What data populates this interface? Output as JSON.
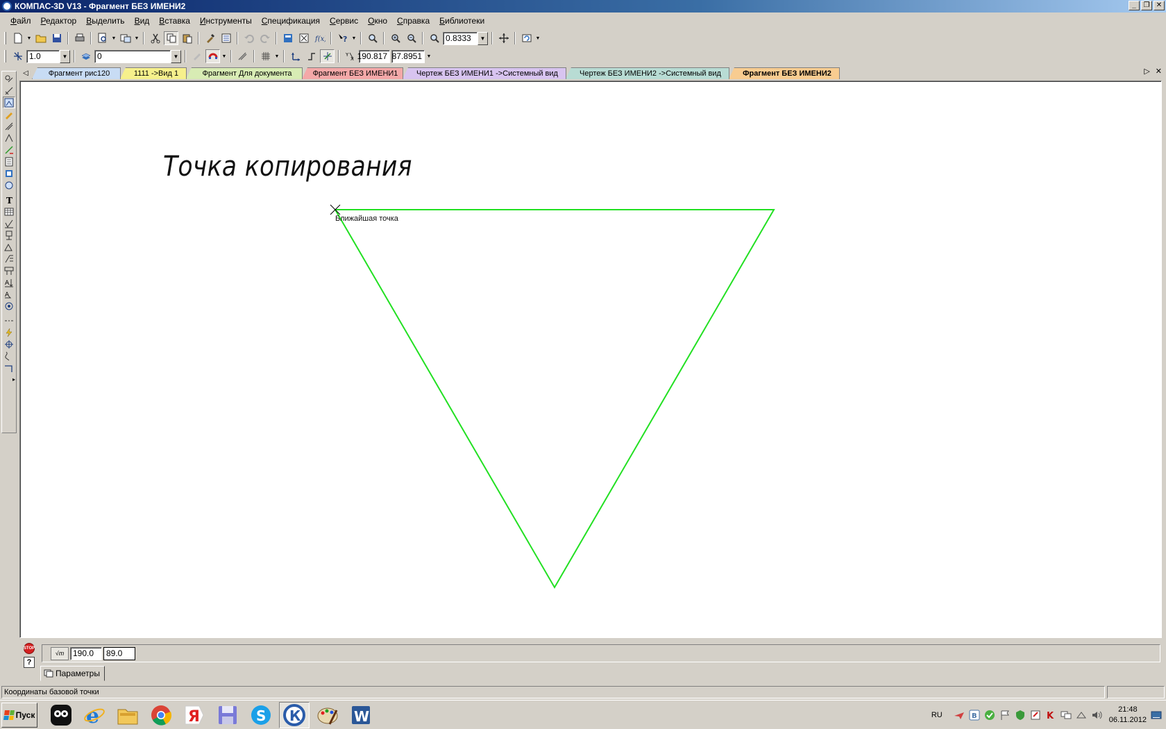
{
  "window": {
    "title": "КОМПАС-3D V13 - Фрагмент БЕЗ ИМЕНИ2"
  },
  "menu": [
    "Файл",
    "Редактор",
    "Выделить",
    "Вид",
    "Вставка",
    "Инструменты",
    "Спецификация",
    "Сервис",
    "Окно",
    "Справка",
    "Библиотеки"
  ],
  "toolbar1": {
    "zoom_value": "0.8333"
  },
  "toolbar2": {
    "step_value": "1.0",
    "layer_value": "0",
    "coord_x": "190.817",
    "coord_y": "87.8951"
  },
  "tabs": [
    {
      "label": "Фрагмент рис120",
      "color": "#c8dcf4"
    },
    {
      "label": "1111 ->Вид 1",
      "color": "#f6f08c"
    },
    {
      "label": "Фрагмент Для документа",
      "color": "#d8ecb4"
    },
    {
      "label": "Фрагмент БЕЗ ИМЕНИ1",
      "color": "#f4a8a8"
    },
    {
      "label": "Чертеж БЕЗ ИМЕНИ1 ->Системный вид",
      "color": "#d8c4f0"
    },
    {
      "label": "Чертеж БЕЗ ИМЕНИ2 ->Системный вид",
      "color": "#b8dcd4"
    },
    {
      "label": "Фрагмент БЕЗ ИМЕНИ2",
      "color": "#f8cc90",
      "active": true
    }
  ],
  "canvas": {
    "drawing_title": "Точка копирования",
    "snap_label": "Ближайшая точка",
    "line_color": "#22e022"
  },
  "properties": {
    "point_x": "190.0",
    "point_y": "89.0",
    "tab_label": "Параметры"
  },
  "status": {
    "message": "Координаты базовой точки"
  },
  "taskbar": {
    "start_label": "Пуск",
    "apps": [
      "pidgin-icon",
      "ie-icon",
      "explorer-icon",
      "chrome-icon",
      "yandex-icon",
      "save-disk-icon",
      "skype-icon",
      "kompas-icon",
      "paint-icon",
      "word-icon"
    ],
    "lang": "RU",
    "time": "21:48",
    "date": "06.11.2012"
  }
}
